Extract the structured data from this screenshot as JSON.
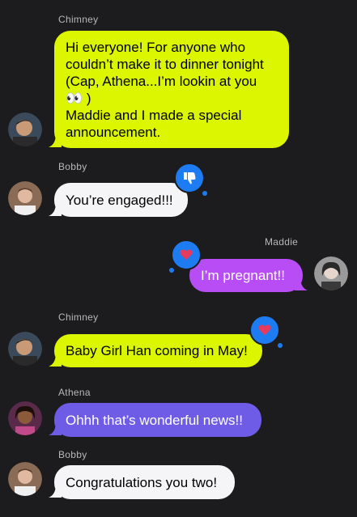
{
  "colors": {
    "background": "#1c1c1e",
    "chimney_bubble": "#dcf500",
    "bobby_bubble": "#f5f5f7",
    "maddie_bubble": "#b84df5",
    "athena_bubble": "#6e5ce6",
    "tapback": "#1e7cf2",
    "heart": "#e83a5c"
  },
  "messages": [
    {
      "sender": "Chimney",
      "text": "Hi everyone! For anyone who\ncouldn’t make it to dinner tonight\n(Cap, Athena...I’m lookin at you\n👀 )\nMaddie and I made a special\nannouncement."
    },
    {
      "sender": "Bobby",
      "text": "You’re engaged!!!",
      "tapback": "thumbs-down-icon"
    },
    {
      "sender": "Maddie",
      "text": "I’m pregnant!!",
      "tapback": "heart-icon"
    },
    {
      "sender": "Chimney",
      "text": "Baby Girl Han coming in May!",
      "tapback": "heart-icon"
    },
    {
      "sender": "Athena",
      "text": "Ohhh that’s wonderful news!!"
    },
    {
      "sender": "Bobby",
      "text": "Congratulations you two!"
    }
  ]
}
